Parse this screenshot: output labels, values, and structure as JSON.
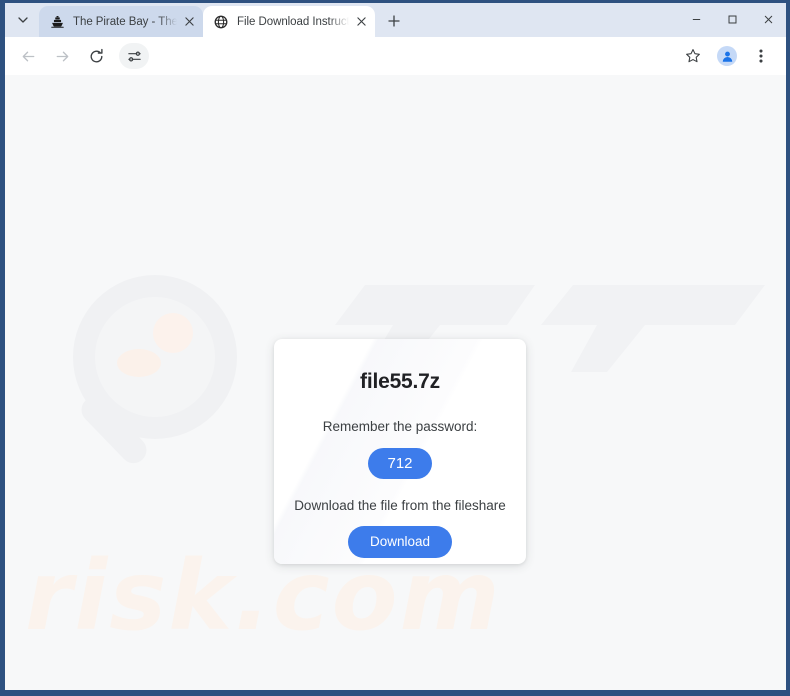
{
  "browser": {
    "tabs": [
      {
        "title": "The Pirate Bay - The galaxy's m",
        "favicon": "ship-icon",
        "active": false,
        "close_label": "×"
      },
      {
        "title": "File Download Instructions for ",
        "favicon": "globe-icon",
        "active": true,
        "close_label": "×"
      }
    ],
    "new_tab_label": "+",
    "tab_list_chevron": "⌄",
    "window_controls": {
      "minimize": "–",
      "maximize": "□",
      "close": "✕"
    },
    "toolbar": {
      "back": "back-arrow-icon",
      "forward": "forward-arrow-icon",
      "reload": "reload-icon",
      "tune": "tune-sliders-icon",
      "address_value": "",
      "address_placeholder": "",
      "bookmark": "star-icon",
      "profile": "profile-avatar-icon",
      "menu": "three-dot-menu-icon"
    }
  },
  "page": {
    "watermark_text": "risk.com",
    "card": {
      "filename": "file55.7z",
      "password_label": "Remember the password:",
      "password_value": "712",
      "download_label": "Download the file from the fileshare",
      "download_button": "Download"
    }
  },
  "colors": {
    "accent_blue": "#3d7ceb",
    "frame_navy": "#2e5180",
    "tabstrip": "#dfe6f2",
    "page_bg": "#f7f8f9"
  }
}
